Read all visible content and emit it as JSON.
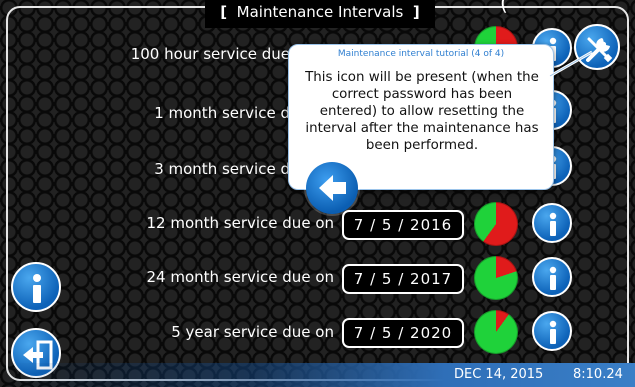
{
  "header": {
    "title": "Maintenance Intervals",
    "bracket_open": "[",
    "bracket_close": "]",
    "peek_text": "("
  },
  "rows": [
    {
      "label": "100 hour service due",
      "date": "",
      "green_fraction": 0.6
    },
    {
      "label": "1 month service d",
      "date": "",
      "green_fraction": null
    },
    {
      "label": "3 month service d",
      "date": "",
      "green_fraction": null
    },
    {
      "label": "12 month service due on",
      "date": "7 / 5 / 2016",
      "green_fraction": 0.4
    },
    {
      "label": "24 month service due on",
      "date": "7 / 5 / 2017",
      "green_fraction": 0.8
    },
    {
      "label": "5 year service due on",
      "date": "7 / 5 / 2020",
      "green_fraction": 0.9
    }
  ],
  "tutorial": {
    "title": "Maintenance interval tutorial (4 of 4)",
    "body": "This icon will be present (when the correct password has been entered) to allow resetting the interval after the maintenance has been performed."
  },
  "status": {
    "date": "DEC 14, 2015",
    "time": "8:10.24"
  },
  "colors": {
    "accent_blue": "#0d62b8",
    "pie_green": "#1fd23a",
    "pie_red": "#e01b1b",
    "tutorial_title": "#2f7fd0"
  },
  "icons": {
    "info": "info-icon",
    "wrench": "wrench-screwdriver-icon",
    "back": "back-arrow-icon",
    "exit": "exit-door-icon"
  }
}
